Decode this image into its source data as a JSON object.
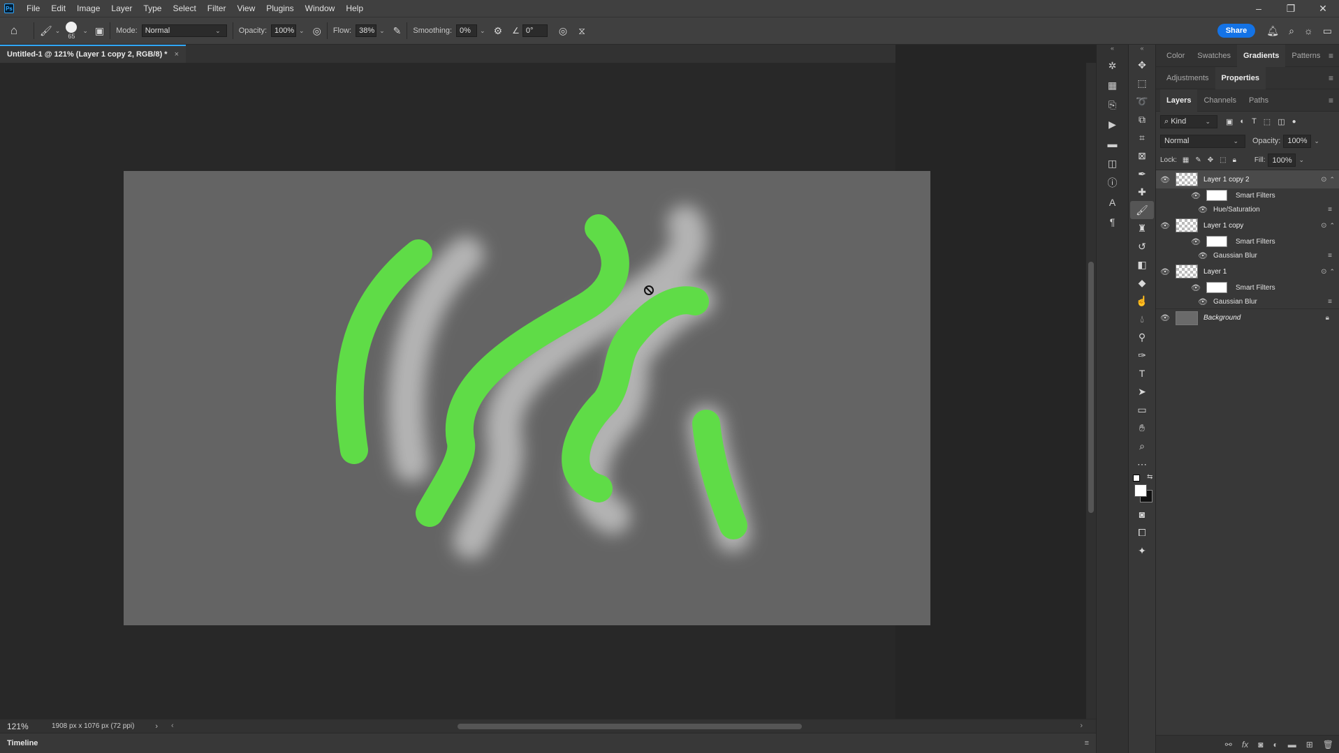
{
  "menubar": {
    "logo": "Ps",
    "items": [
      "File",
      "Edit",
      "Image",
      "Layer",
      "Type",
      "Select",
      "Filter",
      "View",
      "Plugins",
      "Window",
      "Help"
    ],
    "window_controls": [
      "minimize-icon",
      "restore-icon",
      "close-icon"
    ]
  },
  "options": {
    "brush_size": "65",
    "mode_label": "Mode:",
    "mode_value": "Normal",
    "opacity_label": "Opacity:",
    "opacity_value": "100%",
    "flow_label": "Flow:",
    "flow_value": "38%",
    "smoothing_label": "Smoothing:",
    "smoothing_value": "0%",
    "angle_value": "0°",
    "share_label": "Share"
  },
  "document": {
    "tab_title": "Untitled-1 @ 121% (Layer 1 copy 2, RGB/8) *",
    "close_glyph": "×"
  },
  "canvas": {
    "background_color": "#646464",
    "stroke_color": "#5fdc47",
    "glow_color": "#b4b4b4"
  },
  "status": {
    "zoom": "121%",
    "dimensions": "1908 px x 1076 px (72 ppi)",
    "arrow": "›",
    "scroll_left": "‹",
    "scroll_right": "›"
  },
  "timeline": {
    "label": "Timeline"
  },
  "panels": {
    "row1": [
      "Color",
      "Swatches",
      "Gradients",
      "Patterns"
    ],
    "row1_active": "Gradients",
    "row2": [
      "Adjustments",
      "Properties"
    ],
    "row2_active": "Properties",
    "row3": [
      "Layers",
      "Channels",
      "Paths"
    ],
    "row3_active": "Layers",
    "filter_kind": "Kind",
    "blend_mode": "Normal",
    "opacity_label": "Opacity:",
    "opacity_value": "100%",
    "lock_label": "Lock:",
    "fill_label": "Fill:",
    "fill_value": "100%"
  },
  "layers": [
    {
      "name": "Layer 1 copy 2",
      "selected": true,
      "smart_filters": "Smart Filters",
      "filter": "Hue/Saturation"
    },
    {
      "name": "Layer 1 copy",
      "selected": false,
      "smart_filters": "Smart Filters",
      "filter": "Gaussian Blur"
    },
    {
      "name": "Layer 1",
      "selected": false,
      "smart_filters": "Smart Filters",
      "filter": "Gaussian Blur"
    }
  ],
  "background_layer": {
    "name": "Background"
  }
}
